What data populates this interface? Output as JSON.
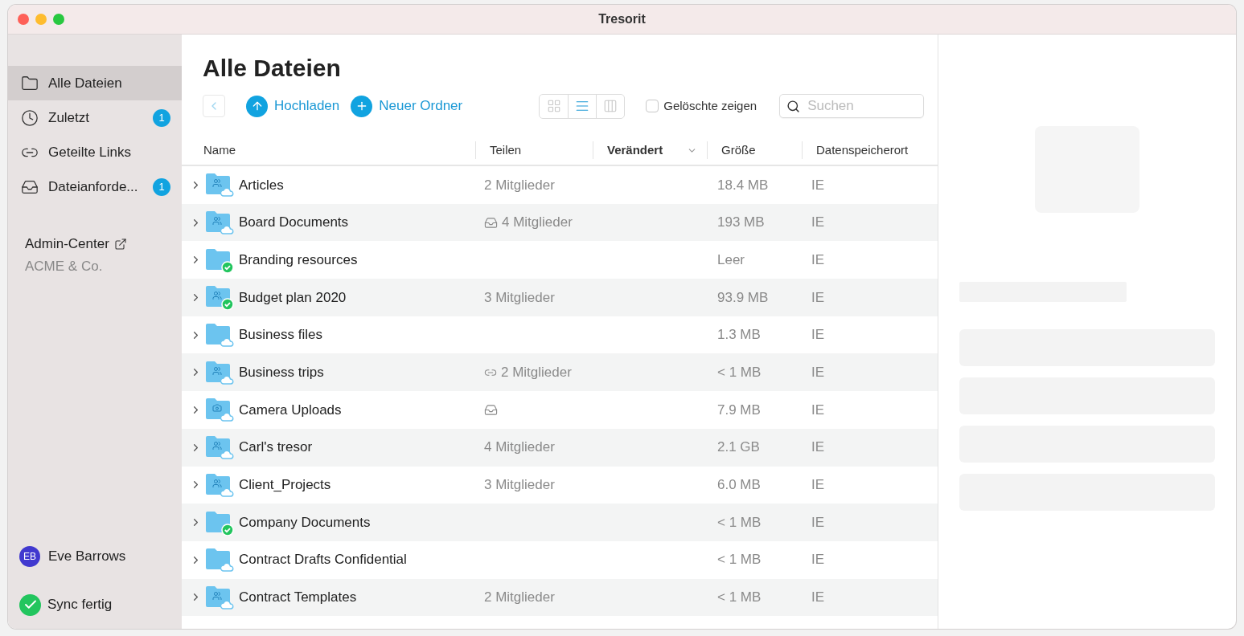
{
  "window": {
    "title": "Tresorit"
  },
  "sidebar": {
    "items": [
      {
        "kind": "folder",
        "label": "Alle Dateien",
        "selected": true
      },
      {
        "kind": "clock",
        "label": "Zuletzt",
        "badge": "1",
        "selected": false
      },
      {
        "kind": "link",
        "label": "Geteilte Links",
        "selected": false
      },
      {
        "kind": "inbox",
        "label": "Dateianforde...",
        "badge": "1",
        "selected": false
      }
    ],
    "admin": {
      "label": "Admin-Center",
      "company": "ACME & Co."
    },
    "user": {
      "initials": "EB",
      "name": "Eve Barrows"
    },
    "sync": {
      "label": "Sync fertig"
    }
  },
  "page": {
    "title": "Alle Dateien"
  },
  "toolbar": {
    "actions": [
      {
        "kind": "upload",
        "label": "Hochladen"
      },
      {
        "kind": "new",
        "label": "Neuer Ordner"
      }
    ],
    "views": [
      {
        "kind": "grid",
        "selected": false
      },
      {
        "kind": "list",
        "selected": true
      },
      {
        "kind": "columns",
        "selected": false
      }
    ],
    "show_deleted": {
      "label": "Gelöschte zeigen",
      "checked": false
    },
    "search": {
      "placeholder": "Suchen"
    }
  },
  "table": {
    "columns": [
      {
        "label": "Name",
        "sorted": false
      },
      {
        "label": "Teilen",
        "sorted": false
      },
      {
        "label": "Verändert",
        "sorted": true
      },
      {
        "label": "Größe",
        "sorted": false
      },
      {
        "label": "Datenspeicherort",
        "sorted": false
      }
    ],
    "rows": [
      {
        "folder_icon": {
          "kind": "shared"
        },
        "sync_badge": {
          "kind": "cloud"
        },
        "name": "Articles",
        "share": "2 Mitglieder",
        "size": "18.4 MB",
        "location": "IE"
      },
      {
        "folder_icon": {
          "kind": "shared"
        },
        "sync_badge": {
          "kind": "cloud"
        },
        "name": "Board Documents",
        "share_icon": {
          "kind": "inbox"
        },
        "share": "4 Mitglieder",
        "size": "193 MB",
        "location": "IE"
      },
      {
        "folder_icon": {
          "kind": "plain"
        },
        "sync_badge": {
          "kind": "check"
        },
        "name": "Branding resources",
        "size": "Leer",
        "location": "IE"
      },
      {
        "folder_icon": {
          "kind": "shared"
        },
        "sync_badge": {
          "kind": "check"
        },
        "name": "Budget plan 2020",
        "share": "3 Mitglieder",
        "size": "93.9 MB",
        "location": "IE"
      },
      {
        "folder_icon": {
          "kind": "plain"
        },
        "sync_badge": {
          "kind": "cloud"
        },
        "name": "Business files",
        "size": "1.3 MB",
        "location": "IE"
      },
      {
        "folder_icon": {
          "kind": "shared"
        },
        "sync_badge": {
          "kind": "cloud"
        },
        "name": "Business trips",
        "share_icon": {
          "kind": "link"
        },
        "share": "2 Mitglieder",
        "size": "< 1 MB",
        "location": "IE"
      },
      {
        "folder_icon": {
          "kind": "camera"
        },
        "sync_badge": {
          "kind": "cloud"
        },
        "name": "Camera Uploads",
        "share_icon": {
          "kind": "inbox"
        },
        "size": "7.9 MB",
        "location": "IE"
      },
      {
        "folder_icon": {
          "kind": "shared"
        },
        "sync_badge": {
          "kind": "cloud"
        },
        "name": "Carl's tresor",
        "share": "4 Mitglieder",
        "size": "2.1 GB",
        "location": "IE"
      },
      {
        "folder_icon": {
          "kind": "shared"
        },
        "sync_badge": {
          "kind": "cloud"
        },
        "name": "Client_Projects",
        "share": "3 Mitglieder",
        "size": "6.0 MB",
        "location": "IE"
      },
      {
        "folder_icon": {
          "kind": "plain"
        },
        "sync_badge": {
          "kind": "check"
        },
        "name": "Company Documents",
        "size": "< 1 MB",
        "location": "IE"
      },
      {
        "folder_icon": {
          "kind": "plain"
        },
        "sync_badge": {
          "kind": "cloud"
        },
        "name": "Contract Drafts Confidential",
        "size": "< 1 MB",
        "location": "IE"
      },
      {
        "folder_icon": {
          "kind": "shared"
        },
        "sync_badge": {
          "kind": "cloud"
        },
        "name": "Contract Templates",
        "share": "2 Mitglieder",
        "size": "< 1 MB",
        "location": "IE"
      }
    ]
  }
}
